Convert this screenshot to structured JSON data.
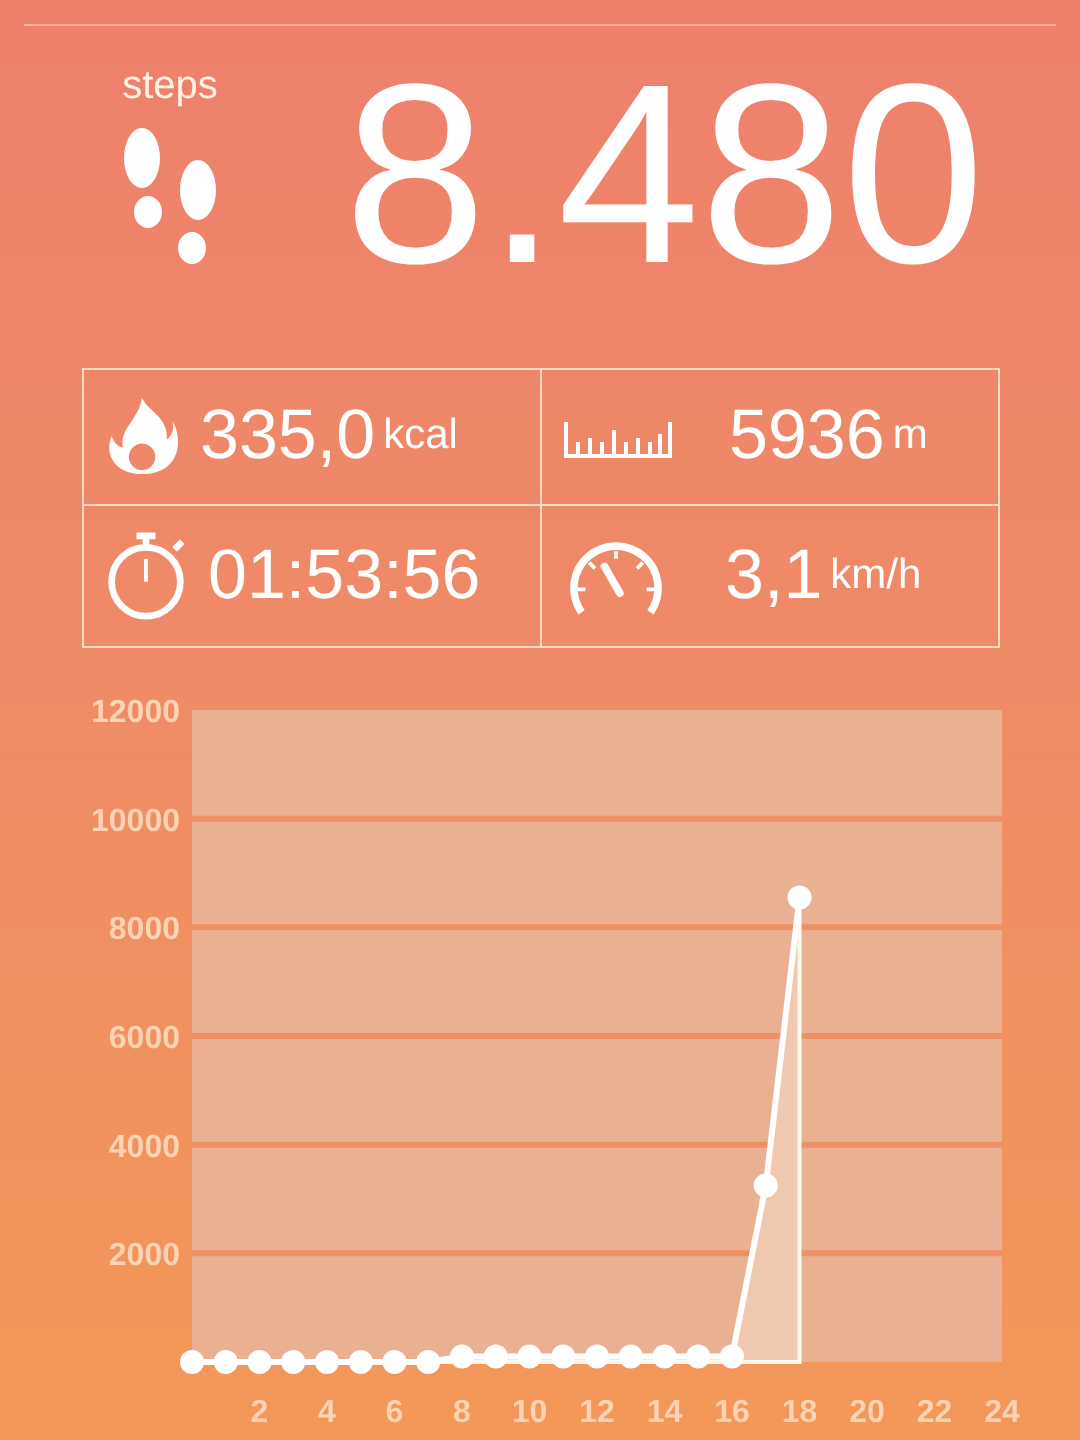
{
  "header": {
    "steps_label": "steps",
    "steps_value": "8.480"
  },
  "stats": [
    {
      "kind": "calories",
      "value": "335,0",
      "unit": "kcal"
    },
    {
      "kind": "distance",
      "value": "5936",
      "unit": "m"
    },
    {
      "kind": "duration",
      "value": "01:53:56"
    },
    {
      "kind": "speed",
      "value": "3,1",
      "unit": "km/h"
    }
  ],
  "chart": {
    "chart_data": {
      "type": "area",
      "x": [
        0,
        1,
        2,
        3,
        4,
        5,
        6,
        7,
        8,
        9,
        10,
        11,
        12,
        13,
        14,
        15,
        16,
        17,
        18
      ],
      "values": [
        0,
        0,
        0,
        0,
        0,
        0,
        0,
        0,
        100,
        100,
        100,
        100,
        100,
        100,
        100,
        100,
        100,
        3250,
        8550
      ],
      "grid": true,
      "xlim": [
        0,
        24
      ],
      "ylim": [
        0,
        12000
      ],
      "xticks": [
        2,
        4,
        6,
        8,
        10,
        12,
        14,
        16,
        18,
        20,
        22,
        24
      ],
      "yticks": [
        2000,
        4000,
        6000,
        8000,
        10000,
        12000
      ]
    }
  }
}
